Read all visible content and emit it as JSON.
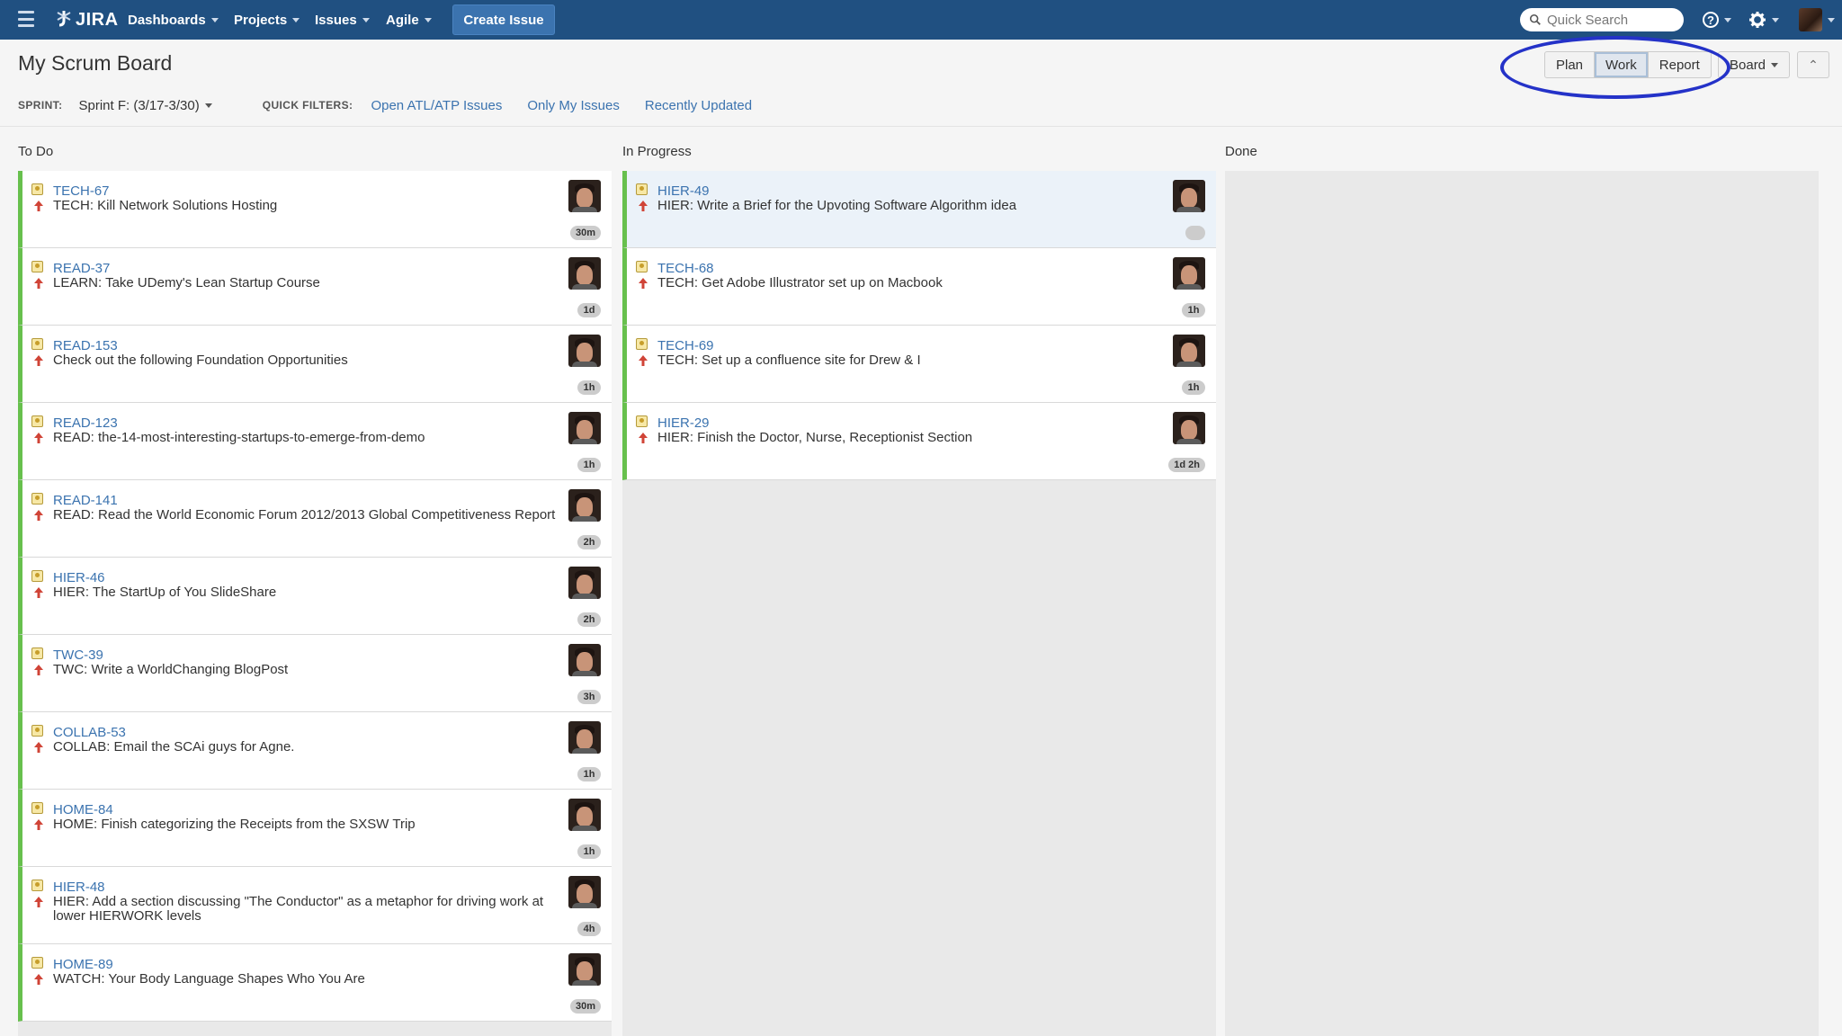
{
  "nav": {
    "logo": "JIRA",
    "menus": [
      "Dashboards",
      "Projects",
      "Issues",
      "Agile"
    ],
    "create_issue": "Create Issue",
    "search_placeholder": "Quick Search"
  },
  "board": {
    "title": "My Scrum Board",
    "modes": {
      "plan": "Plan",
      "work": "Work",
      "report": "Report",
      "active": "Work"
    },
    "board_menu": "Board",
    "sprint_label": "SPRINT:",
    "sprint_value": "Sprint F: (3/17-3/30)",
    "quick_filters_label": "QUICK FILTERS:",
    "quick_filters": [
      "Open ATL/ATP Issues",
      "Only My Issues",
      "Recently Updated"
    ]
  },
  "columns": {
    "todo": {
      "title": "To Do",
      "issues": [
        {
          "key": "TECH-67",
          "summary": "TECH: Kill Network Solutions Hosting",
          "estimate": "30m"
        },
        {
          "key": "READ-37",
          "summary": "LEARN: Take UDemy's Lean Startup Course",
          "estimate": "1d"
        },
        {
          "key": "READ-153",
          "summary": "Check out the following Foundation Opportunities",
          "estimate": "1h"
        },
        {
          "key": "READ-123",
          "summary": "READ: the-14-most-interesting-startups-to-emerge-from-demo",
          "estimate": "1h"
        },
        {
          "key": "READ-141",
          "summary": "READ: Read the World Economic Forum 2012/2013 Global Competitiveness Report",
          "estimate": "2h"
        },
        {
          "key": "HIER-46",
          "summary": "HIER: The StartUp of You SlideShare",
          "estimate": "2h"
        },
        {
          "key": "TWC-39",
          "summary": "TWC: Write a WorldChanging BlogPost",
          "estimate": "3h"
        },
        {
          "key": "COLLAB-53",
          "summary": "COLLAB: Email the SCAi guys for Agne.",
          "estimate": "1h"
        },
        {
          "key": "HOME-84",
          "summary": "HOME: Finish categorizing the Receipts from the SXSW Trip",
          "estimate": "1h"
        },
        {
          "key": "HIER-48",
          "summary": "HIER: Add a section discussing \"The Conductor\" as a metaphor for driving work at lower HIERWORK levels",
          "estimate": "4h"
        },
        {
          "key": "HOME-89",
          "summary": "WATCH: Your Body Language Shapes Who You Are",
          "estimate": "30m"
        }
      ]
    },
    "in_progress": {
      "title": "In Progress",
      "issues": [
        {
          "key": "HIER-49",
          "summary": "HIER: Write a Brief for the Upvoting Software Algorithm idea",
          "estimate": "",
          "selected": true
        },
        {
          "key": "TECH-68",
          "summary": "TECH: Get Adobe Illustrator set up on Macbook",
          "estimate": "1h"
        },
        {
          "key": "TECH-69",
          "summary": "TECH: Set up a confluence site for Drew & I",
          "estimate": "1h"
        },
        {
          "key": "HIER-29",
          "summary": "HIER: Finish the Doctor, Nurse, Receptionist Section",
          "estimate": "1d 2h"
        }
      ]
    },
    "done": {
      "title": "Done",
      "issues": []
    }
  },
  "colors": {
    "nav_bg": "#205081",
    "link": "#3b73af",
    "card_border": "#67c04d",
    "highlight_ring": "#2432c8"
  },
  "icons": {
    "type": "story-icon",
    "priority": "priority-major-up-arrow-icon"
  }
}
